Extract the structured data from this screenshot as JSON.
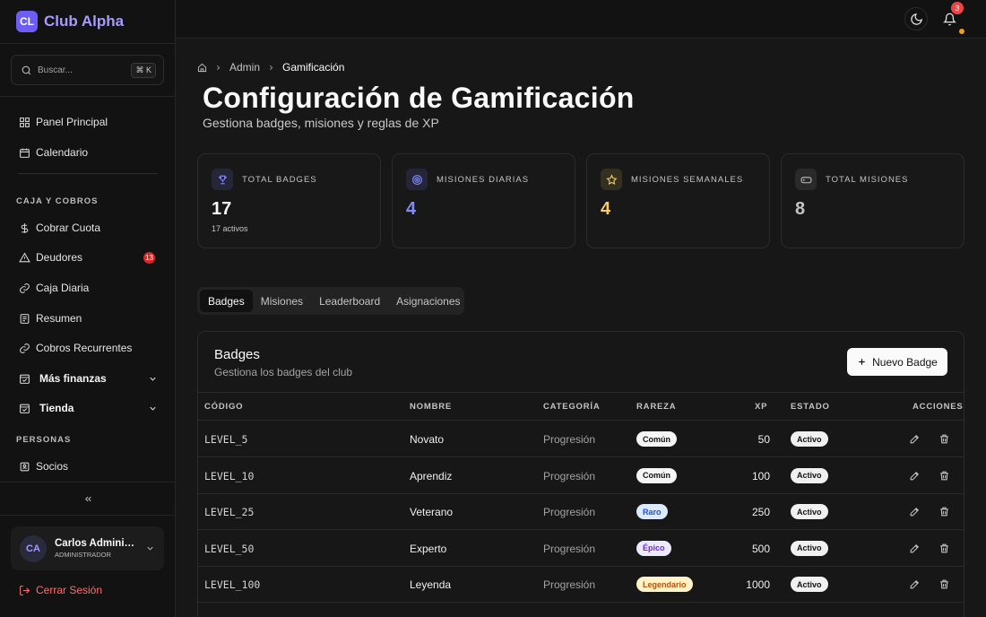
{
  "brand": {
    "logo": "CL",
    "name": "Club Alpha",
    "accent": "#6d5df5"
  },
  "search": {
    "placeholder": "Buscar...",
    "shortcut": "⌘ K"
  },
  "sidebar": {
    "top_items": [
      {
        "label": "Panel Principal",
        "icon": "dashboard-icon"
      },
      {
        "label": "Calendario",
        "icon": "calendar-icon"
      }
    ],
    "section_caja": "CAJA Y COBROS",
    "caja_items": [
      {
        "label": "Cobrar Cuota",
        "icon": "coin-icon"
      },
      {
        "label": "Deudores",
        "icon": "warning-icon",
        "badge": "13"
      },
      {
        "label": "Caja Diaria",
        "icon": "wallet-icon"
      },
      {
        "label": "Resumen",
        "icon": "receipt-icon"
      },
      {
        "label": "Cobros Recurrentes",
        "icon": "refresh-icon"
      }
    ],
    "groups": [
      {
        "label": "Más finanzas",
        "icon": "finance-icon"
      },
      {
        "label": "Tienda",
        "icon": "shop-icon"
      }
    ],
    "section_personas": "PERSONAS",
    "personas_items": [
      {
        "label": "Socios",
        "icon": "members-icon"
      }
    ]
  },
  "user": {
    "initials": "CA",
    "name": "Carlos Administrador",
    "role": "ADMINISTRADOR"
  },
  "logout_label": "Cerrar Sesión",
  "topbar": {
    "notifications": "3"
  },
  "breadcrumb": {
    "parent": "Admin",
    "current": "Gamificación"
  },
  "page": {
    "title": "Configuración de Gamificación",
    "subtitle": "Gestiona badges, misiones y reglas de XP"
  },
  "stats": [
    {
      "label": "TOTAL BADGES",
      "value": "17",
      "sub": "17 activos",
      "icon": "trophy-icon",
      "color": "#fafafa",
      "icon_color": "#818cf8"
    },
    {
      "label": "MISIONES DIARIAS",
      "value": "4",
      "sub": "",
      "icon": "target-icon",
      "color": "#818cf8",
      "icon_color": "#818cf8"
    },
    {
      "label": "MISIONES SEMANALES",
      "value": "4",
      "sub": "",
      "icon": "star-icon",
      "color": "#facc6b",
      "icon_color": "#facc6b"
    },
    {
      "label": "TOTAL MISIONES",
      "value": "8",
      "sub": "",
      "icon": "gamepad-icon",
      "color": "#c4c4c4",
      "icon_color": "#c4c4c4"
    }
  ],
  "tabs": [
    "Badges",
    "Misiones",
    "Leaderboard",
    "Asignaciones"
  ],
  "panel": {
    "title": "Badges",
    "subtitle": "Gestiona los badges del club",
    "new_button": "Nuevo Badge"
  },
  "table": {
    "headers": {
      "code": "CÓDIGO",
      "name": "NOMBRE",
      "category": "CATEGORÍA",
      "rarity": "RAREZA",
      "xp": "XP",
      "status": "ESTADO",
      "actions": "ACCIONES"
    },
    "rows": [
      {
        "code": "LEVEL_5",
        "name": "Novato",
        "category": "Progresión",
        "rarity": "Común",
        "rarity_bg": "#f5f5f5",
        "rarity_fg": "#111111",
        "xp": "50",
        "status": "Activo"
      },
      {
        "code": "LEVEL_10",
        "name": "Aprendiz",
        "category": "Progresión",
        "rarity": "Común",
        "rarity_bg": "#f5f5f5",
        "rarity_fg": "#111111",
        "xp": "100",
        "status": "Activo"
      },
      {
        "code": "LEVEL_25",
        "name": "Veterano",
        "category": "Progresión",
        "rarity": "Raro",
        "rarity_bg": "#dbeafe",
        "rarity_fg": "#1d4ed8",
        "xp": "250",
        "status": "Activo"
      },
      {
        "code": "LEVEL_50",
        "name": "Experto",
        "category": "Progresión",
        "rarity": "Épico",
        "rarity_bg": "#ede9fe",
        "rarity_fg": "#6d28d9",
        "xp": "500",
        "status": "Activo"
      },
      {
        "code": "LEVEL_100",
        "name": "Leyenda",
        "category": "Progresión",
        "rarity": "Legendario",
        "rarity_bg": "#fef3c7",
        "rarity_fg": "#b45309",
        "xp": "1000",
        "status": "Activo"
      }
    ]
  }
}
